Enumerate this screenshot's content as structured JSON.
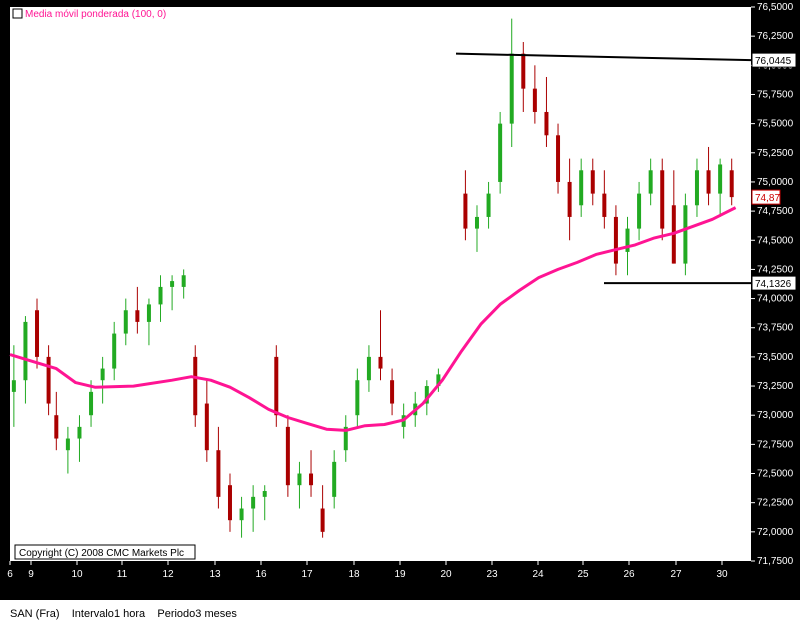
{
  "chart_data": {
    "type": "candlestick",
    "indicator_label": "Media móvil ponderada (100, 0)",
    "copyright": "Copyright (C) 2008 CMC Markets Plc",
    "ylim": [
      71.75,
      76.5
    ],
    "y_ticks": [
      "76,5000",
      "76,2500",
      "76,0000",
      "75,7500",
      "75,5000",
      "75,2500",
      "75,0000",
      "74,7500",
      "74,5000",
      "74,2500",
      "74,0000",
      "73,7500",
      "73,5000",
      "73,2500",
      "73,0000",
      "72,7500",
      "72,5000",
      "72,2500",
      "72,0000",
      "71,7500"
    ],
    "x_ticks": [
      "6",
      "9",
      "10",
      "11",
      "12",
      "13",
      "16",
      "17",
      "18",
      "19",
      "20",
      "23",
      "24",
      "25",
      "26",
      "27",
      "30"
    ],
    "annotations": [
      {
        "label": "76,0445",
        "value": 76.0445
      },
      {
        "label": "74,1326",
        "value": 74.1326
      },
      {
        "label": "74,87",
        "value": 74.87
      }
    ],
    "trendlines": [
      {
        "from": {
          "x_index": 20.3,
          "value": 76.1
        },
        "to": {
          "x_index": 31.6,
          "value": 76.0445
        }
      },
      {
        "from": {
          "x_index": 25.4,
          "value": 74.1326
        },
        "to": {
          "x_index": 31.6,
          "value": 74.1326
        }
      }
    ],
    "moving_average": [
      [
        5.8,
        73.52
      ],
      [
        6.3,
        73.47
      ],
      [
        7.0,
        73.4
      ],
      [
        7.5,
        73.28
      ],
      [
        8.0,
        73.24
      ],
      [
        9.0,
        73.25
      ],
      [
        10.0,
        73.3
      ],
      [
        10.5,
        73.33
      ],
      [
        11.0,
        73.3
      ],
      [
        11.5,
        73.24
      ],
      [
        12.0,
        73.15
      ],
      [
        12.5,
        73.05
      ],
      [
        13.0,
        72.98
      ],
      [
        13.5,
        72.93
      ],
      [
        14.0,
        72.88
      ],
      [
        14.5,
        72.87
      ],
      [
        15.0,
        72.91
      ],
      [
        15.5,
        72.92
      ],
      [
        16.0,
        72.96
      ],
      [
        16.5,
        73.1
      ],
      [
        17.0,
        73.3
      ],
      [
        17.5,
        73.55
      ],
      [
        18.0,
        73.78
      ],
      [
        18.5,
        73.95
      ],
      [
        19.0,
        74.07
      ],
      [
        19.5,
        74.18
      ],
      [
        20.0,
        74.25
      ],
      [
        20.5,
        74.31
      ],
      [
        21.0,
        74.38
      ],
      [
        21.5,
        74.42
      ],
      [
        22.0,
        74.46
      ],
      [
        22.5,
        74.52
      ],
      [
        23.0,
        74.56
      ],
      [
        23.5,
        74.62
      ],
      [
        24.0,
        74.68
      ],
      [
        24.3,
        74.73
      ],
      [
        24.6,
        74.78
      ]
    ],
    "candles": [
      {
        "x": 5.9,
        "o": 73.2,
        "h": 73.6,
        "l": 72.9,
        "c": 73.3
      },
      {
        "x": 6.2,
        "o": 73.3,
        "h": 73.85,
        "l": 73.1,
        "c": 73.8
      },
      {
        "x": 6.5,
        "o": 73.9,
        "h": 74.0,
        "l": 73.4,
        "c": 73.5
      },
      {
        "x": 6.8,
        "o": 73.5,
        "h": 73.6,
        "l": 73.0,
        "c": 73.1
      },
      {
        "x": 7.0,
        "o": 73.0,
        "h": 73.2,
        "l": 72.7,
        "c": 72.8
      },
      {
        "x": 7.3,
        "o": 72.7,
        "h": 72.9,
        "l": 72.5,
        "c": 72.8
      },
      {
        "x": 7.6,
        "o": 72.8,
        "h": 73.0,
        "l": 72.6,
        "c": 72.9
      },
      {
        "x": 7.9,
        "o": 73.0,
        "h": 73.3,
        "l": 72.9,
        "c": 73.2
      },
      {
        "x": 8.2,
        "o": 73.3,
        "h": 73.5,
        "l": 73.1,
        "c": 73.4
      },
      {
        "x": 8.5,
        "o": 73.4,
        "h": 73.8,
        "l": 73.3,
        "c": 73.7
      },
      {
        "x": 8.8,
        "o": 73.7,
        "h": 74.0,
        "l": 73.6,
        "c": 73.9
      },
      {
        "x": 9.1,
        "o": 73.9,
        "h": 74.1,
        "l": 73.7,
        "c": 73.8
      },
      {
        "x": 9.4,
        "o": 73.8,
        "h": 74.0,
        "l": 73.6,
        "c": 73.95
      },
      {
        "x": 9.7,
        "o": 73.95,
        "h": 74.2,
        "l": 73.8,
        "c": 74.1
      },
      {
        "x": 10.0,
        "o": 74.1,
        "h": 74.2,
        "l": 73.9,
        "c": 74.15
      },
      {
        "x": 10.3,
        "o": 74.1,
        "h": 74.25,
        "l": 74.0,
        "c": 74.2
      },
      {
        "x": 10.6,
        "o": 73.5,
        "h": 73.6,
        "l": 72.9,
        "c": 73.0
      },
      {
        "x": 10.9,
        "o": 73.1,
        "h": 73.3,
        "l": 72.6,
        "c": 72.7
      },
      {
        "x": 11.2,
        "o": 72.7,
        "h": 72.9,
        "l": 72.2,
        "c": 72.3
      },
      {
        "x": 11.5,
        "o": 72.4,
        "h": 72.5,
        "l": 72.0,
        "c": 72.1
      },
      {
        "x": 11.8,
        "o": 72.1,
        "h": 72.3,
        "l": 71.95,
        "c": 72.2
      },
      {
        "x": 12.1,
        "o": 72.2,
        "h": 72.4,
        "l": 72.0,
        "c": 72.3
      },
      {
        "x": 12.4,
        "o": 72.3,
        "h": 72.4,
        "l": 72.1,
        "c": 72.35
      },
      {
        "x": 12.7,
        "o": 73.5,
        "h": 73.6,
        "l": 72.9,
        "c": 73.0
      },
      {
        "x": 13.0,
        "o": 72.9,
        "h": 73.0,
        "l": 72.3,
        "c": 72.4
      },
      {
        "x": 13.3,
        "o": 72.4,
        "h": 72.6,
        "l": 72.2,
        "c": 72.5
      },
      {
        "x": 13.6,
        "o": 72.5,
        "h": 72.7,
        "l": 72.3,
        "c": 72.4
      },
      {
        "x": 13.9,
        "o": 72.2,
        "h": 72.4,
        "l": 71.95,
        "c": 72.0
      },
      {
        "x": 14.2,
        "o": 72.3,
        "h": 72.7,
        "l": 72.2,
        "c": 72.6
      },
      {
        "x": 14.5,
        "o": 72.7,
        "h": 73.0,
        "l": 72.6,
        "c": 72.9
      },
      {
        "x": 14.8,
        "o": 73.0,
        "h": 73.4,
        "l": 72.9,
        "c": 73.3
      },
      {
        "x": 15.1,
        "o": 73.3,
        "h": 73.6,
        "l": 73.2,
        "c": 73.5
      },
      {
        "x": 15.4,
        "o": 73.5,
        "h": 73.9,
        "l": 73.3,
        "c": 73.4
      },
      {
        "x": 15.7,
        "o": 73.3,
        "h": 73.4,
        "l": 73.0,
        "c": 73.1
      },
      {
        "x": 16.0,
        "o": 72.9,
        "h": 73.1,
        "l": 72.8,
        "c": 73.0
      },
      {
        "x": 16.3,
        "o": 73.0,
        "h": 73.2,
        "l": 72.9,
        "c": 73.1
      },
      {
        "x": 16.6,
        "o": 73.1,
        "h": 73.3,
        "l": 73.0,
        "c": 73.25
      },
      {
        "x": 16.9,
        "o": 73.25,
        "h": 73.4,
        "l": 73.2,
        "c": 73.35
      },
      {
        "x": 17.6,
        "o": 74.9,
        "h": 75.1,
        "l": 74.5,
        "c": 74.6
      },
      {
        "x": 17.9,
        "o": 74.6,
        "h": 74.8,
        "l": 74.4,
        "c": 74.7
      },
      {
        "x": 18.2,
        "o": 74.7,
        "h": 75.0,
        "l": 74.6,
        "c": 74.9
      },
      {
        "x": 18.5,
        "o": 75.0,
        "h": 75.6,
        "l": 74.9,
        "c": 75.5
      },
      {
        "x": 18.8,
        "o": 75.5,
        "h": 76.4,
        "l": 75.3,
        "c": 76.1
      },
      {
        "x": 19.1,
        "o": 76.1,
        "h": 76.2,
        "l": 75.6,
        "c": 75.8
      },
      {
        "x": 19.4,
        "o": 75.8,
        "h": 76.0,
        "l": 75.5,
        "c": 75.6
      },
      {
        "x": 19.7,
        "o": 75.6,
        "h": 75.9,
        "l": 75.3,
        "c": 75.4
      },
      {
        "x": 20.0,
        "o": 75.4,
        "h": 75.5,
        "l": 74.9,
        "c": 75.0
      },
      {
        "x": 20.3,
        "o": 75.0,
        "h": 75.2,
        "l": 74.5,
        "c": 74.7
      },
      {
        "x": 20.6,
        "o": 74.8,
        "h": 75.2,
        "l": 74.7,
        "c": 75.1
      },
      {
        "x": 20.9,
        "o": 75.1,
        "h": 75.2,
        "l": 74.8,
        "c": 74.9
      },
      {
        "x": 21.2,
        "o": 74.9,
        "h": 75.1,
        "l": 74.6,
        "c": 74.7
      },
      {
        "x": 21.5,
        "o": 74.7,
        "h": 74.8,
        "l": 74.2,
        "c": 74.3
      },
      {
        "x": 21.8,
        "o": 74.4,
        "h": 74.7,
        "l": 74.2,
        "c": 74.6
      },
      {
        "x": 22.1,
        "o": 74.6,
        "h": 75.0,
        "l": 74.5,
        "c": 74.9
      },
      {
        "x": 22.4,
        "o": 74.9,
        "h": 75.2,
        "l": 74.8,
        "c": 75.1
      },
      {
        "x": 22.7,
        "o": 75.1,
        "h": 75.2,
        "l": 74.5,
        "c": 74.6
      },
      {
        "x": 23.0,
        "o": 74.8,
        "h": 75.1,
        "l": 74.3,
        "c": 74.3
      },
      {
        "x": 23.3,
        "o": 74.3,
        "h": 74.9,
        "l": 74.2,
        "c": 74.8
      },
      {
        "x": 23.6,
        "o": 74.8,
        "h": 75.2,
        "l": 74.7,
        "c": 75.1
      },
      {
        "x": 23.9,
        "o": 75.1,
        "h": 75.3,
        "l": 74.8,
        "c": 74.9
      },
      {
        "x": 24.2,
        "o": 74.9,
        "h": 75.2,
        "l": 74.7,
        "c": 75.15
      },
      {
        "x": 24.5,
        "o": 75.1,
        "h": 75.2,
        "l": 74.8,
        "c": 74.87
      }
    ]
  },
  "footer": {
    "symbol": "SAN (Fra)",
    "interval_label": "Intervalo",
    "interval_value": "1 hora",
    "period_label": "Periodo",
    "period_value": "3 meses"
  }
}
